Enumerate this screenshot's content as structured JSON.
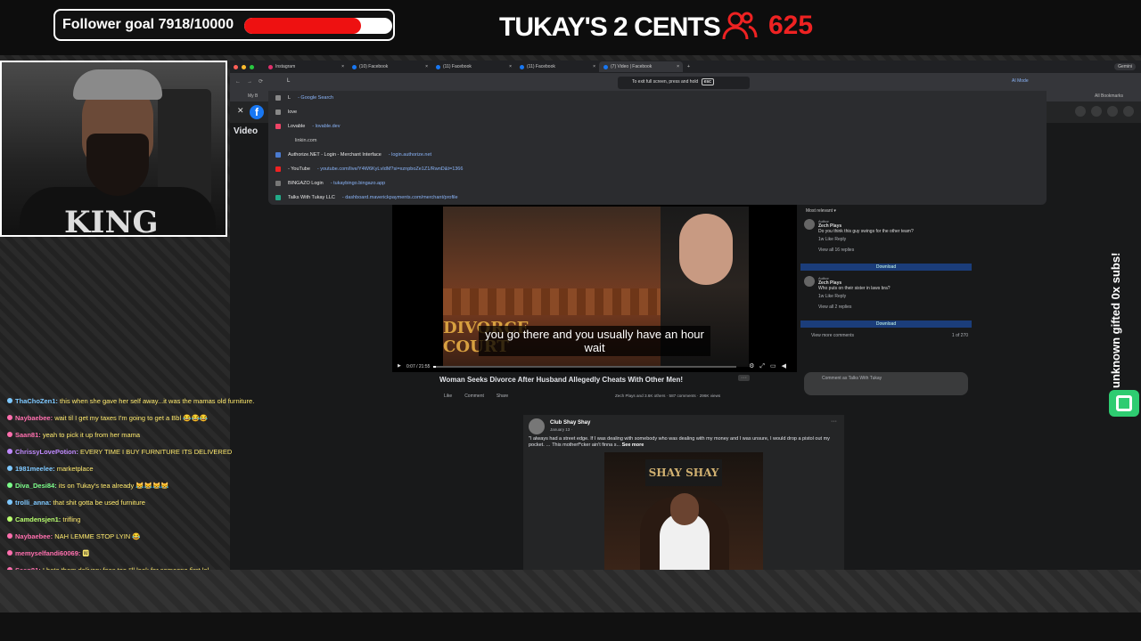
{
  "overlay": {
    "goal_label": "Follower goal 7918/10000",
    "goal_current": 7918,
    "goal_target": 10000,
    "goal_fraction": 0.7918,
    "brand": "TUKAY'S 2 CENTS",
    "viewer_count": "625",
    "subs_text": "unknown gifted 0x subs!"
  },
  "browser": {
    "tabs": [
      {
        "label": "Instagram"
      },
      {
        "label": "(10) Facebook"
      },
      {
        "label": "(11) Facebook"
      },
      {
        "label": "(11) Facebook"
      },
      {
        "label": "(7) Video | Facebook"
      }
    ],
    "new_tab": "+",
    "profile": "Gemini",
    "typed": "L",
    "ai_mode": "AI Mode",
    "bookmarks_left": "My B",
    "bookmarks_right": "All Bookmarks",
    "fullscreen_tip": "To exit full screen, press and hold",
    "fullscreen_key": "esc",
    "suggestions": [
      {
        "main": "L",
        "url": " - Google Search"
      },
      {
        "main": "love",
        "url": ""
      },
      {
        "main": "Lovable",
        "url": " - lovable.dev"
      },
      {
        "main": "",
        "url": "linkin.com"
      },
      {
        "main": "Authorize.NET - Login - Merchant Interface",
        "url": " - login.authorize.net"
      },
      {
        "main": "- YouTube",
        "url": " - youtube.com/live/Y4W6KyLvIdM?si=xznpboZe1Z1/RwnD&t=1366"
      },
      {
        "main": "BINGAZO Login",
        "url": " - tukaybingo.bingazo.app"
      },
      {
        "main": "Talks With Tukay LLC",
        "url": " - dashboard.maverickpayments.com/merchant/profile"
      }
    ]
  },
  "facebook": {
    "section": "Video",
    "caption": "you go there and you usually have an hour wait",
    "court_logo": "DIVORCE COURT",
    "time": "0:07 / 21:55",
    "video_title": "Woman Seeks Divorce After Husband Allegedly Cheats With Other Men!",
    "actions": [
      "Like",
      "Comment",
      "Share"
    ],
    "stats": "Zech Plays and 3.6K others · 587 comments · 296K views",
    "sort": "Most relevant",
    "comments": [
      {
        "author_tag": "Author",
        "name": "Zech Plays",
        "text": "Do you think this guy swings for the other team?",
        "meta": "1w  Like  Reply",
        "replies": "View all 16 replies"
      },
      {
        "author_tag": "Author",
        "name": "Zech Plays",
        "text": "Who puts on their sister in laws bra?",
        "meta": "1w  Like  Reply",
        "replies": "View all 2 replies"
      }
    ],
    "download": "Download",
    "view_more": "View more comments",
    "count": "1 of 270",
    "comment_placeholder": "Comment as Talks With Tukay",
    "post": {
      "name": "Club Shay Shay",
      "date": "January 13 · ",
      "text": "\"I always had a street edge. If I was dealing with somebody who was dealing with my money and I was unsure, I would drop a pistol out my pocket. … This motherf*cker ain't finna s...",
      "see_more": "See more",
      "sign": "SHAY SHAY"
    }
  },
  "chat": [
    {
      "user": "ThaChoZen1:",
      "text": "this when she gave her self away...it was the mamas old furniture.",
      "color": "#7ec8ff"
    },
    {
      "user": "Naybaebee:",
      "text": "wait til I get my taxes I'm going to get a Bbl 😂😂😂",
      "color": "#ff6fae"
    },
    {
      "user": "Saan81:",
      "text": "yeah to pick it up from her mama",
      "color": "#ff6fae"
    },
    {
      "user": "ChrissyLovePotion:",
      "text": "EVERY TIME I BUY FURNITURE ITS DELIVERED",
      "color": "#c08aff"
    },
    {
      "user": "1981meelee:",
      "text": "marketplace",
      "color": "#7ec8ff"
    },
    {
      "user": "Diva_Desi84:",
      "text": "its on Tukay's tea already 😹😹😹😹",
      "color": "#7cff8a"
    },
    {
      "user": "trolli_anna:",
      "text": "that shit gotta be used furniture",
      "color": "#7ec8ff"
    },
    {
      "user": "Camdensjen1:",
      "text": "trifling",
      "color": "#b9ff6e"
    },
    {
      "user": "Naybaebee:",
      "text": "NAH LEMME STOP LYIN 😂",
      "color": "#ff6fae"
    },
    {
      "user": "memyselfandi60069:",
      "text": "🆆",
      "color": "#ff6fae"
    },
    {
      "user": "Saan81:",
      "text": "I hate them delivery fees too I'll look for someone first lol",
      "color": "#ff6fae"
    }
  ],
  "colors": {
    "accent_red": "#e11111",
    "fb_blue": "#1877f2",
    "chat_text": "#ffea6e",
    "sub_green": "#2ecc71"
  }
}
